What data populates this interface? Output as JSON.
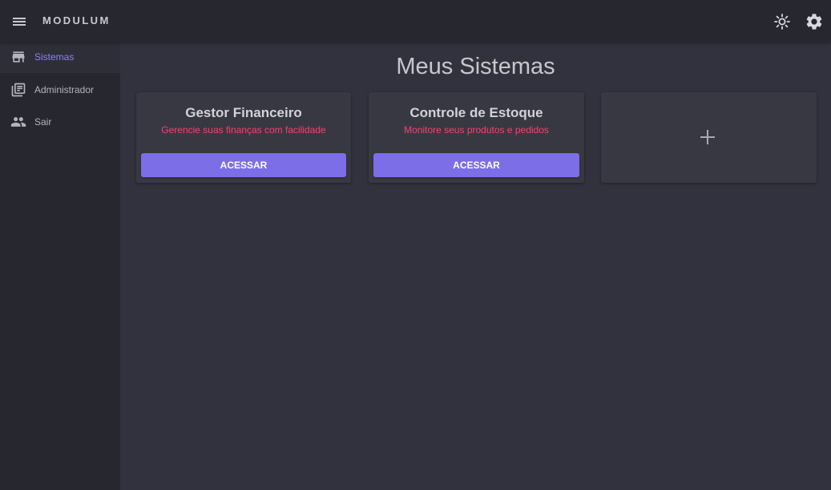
{
  "app": {
    "brand": "MODULUM"
  },
  "header": {
    "icons": {
      "menu": "menu-icon",
      "theme": "sun-icon",
      "settings": "gear-icon"
    }
  },
  "sidebar": {
    "items": [
      {
        "label": "Sistemas",
        "icon": "store-icon",
        "active": true
      },
      {
        "label": "Administrador",
        "icon": "library-icon",
        "active": false
      },
      {
        "label": "Sair",
        "icon": "people-icon",
        "active": false
      }
    ]
  },
  "main": {
    "title": "Meus Sistemas",
    "cards": [
      {
        "title": "Gestor Financeiro",
        "subtitle": "Gerencie suas finanças com facilidade",
        "button": "ACESSAR"
      },
      {
        "title": "Controle de Estoque",
        "subtitle": "Monitore seus produtos e pedidos",
        "button": "ACESSAR"
      }
    ],
    "add_card_icon": "plus-icon"
  },
  "colors": {
    "accent": "#7b6ee7",
    "subtitle": "#f5426f",
    "active_nav": "#8c82f2",
    "background": "#32323e",
    "sidebar": "#27272f"
  }
}
